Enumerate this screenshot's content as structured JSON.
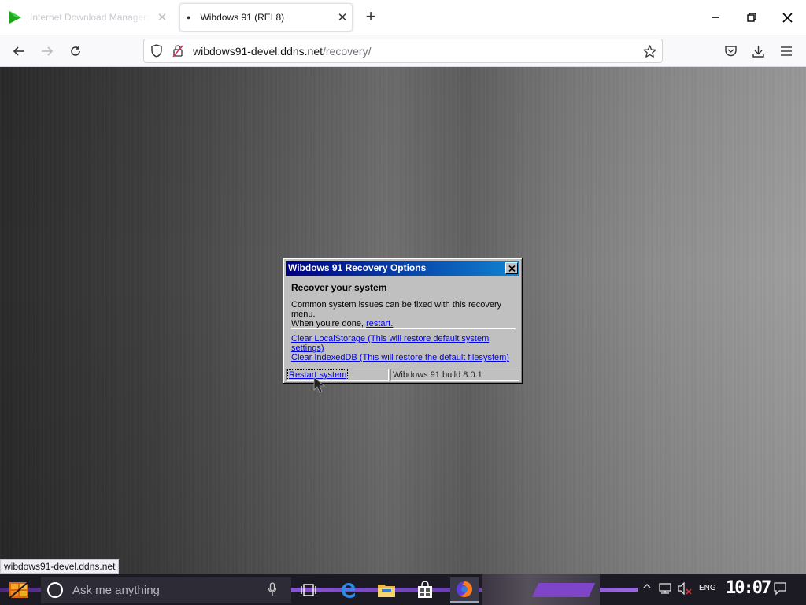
{
  "browser": {
    "tabs": [
      {
        "title": "Internet Download Manager: The fa",
        "active": false
      },
      {
        "title": "Wibdows 91 (REL8)",
        "active": true
      }
    ],
    "url": {
      "host": "wibdows91-devel.ddns.net",
      "path": "/recovery/"
    },
    "link_status": "wibdows91-devel.ddns.net"
  },
  "dialog": {
    "title": "Wibdows 91 Recovery Options",
    "heading": "Recover your system",
    "body_line1": "Common system issues can be fixed with this recovery menu.",
    "body_line2_prefix": "When you're done,",
    "body_restart_link": "restart.",
    "option_localstorage": "Clear LocalStorage (This will restore default system settings)",
    "option_indexeddb": "Clear IndexedDB (This will restore the default filesystem)",
    "restart_system": "Restart system",
    "build": "Wibdows 91 build 8.0.1"
  },
  "taskbar": {
    "search_placeholder": "Ask me anything",
    "apps": [
      "task-view-icon",
      "edge-icon",
      "file-explorer-icon",
      "store-icon",
      "firefox-icon"
    ],
    "language": "ENG",
    "clock": "10:07"
  },
  "colors": {
    "titlebar_start": "#000080",
    "titlebar_end": "#1084d0",
    "dialog_face": "#c0c0c0",
    "link": "#0000ee",
    "taskbar_accent": "#8e5ad8"
  }
}
